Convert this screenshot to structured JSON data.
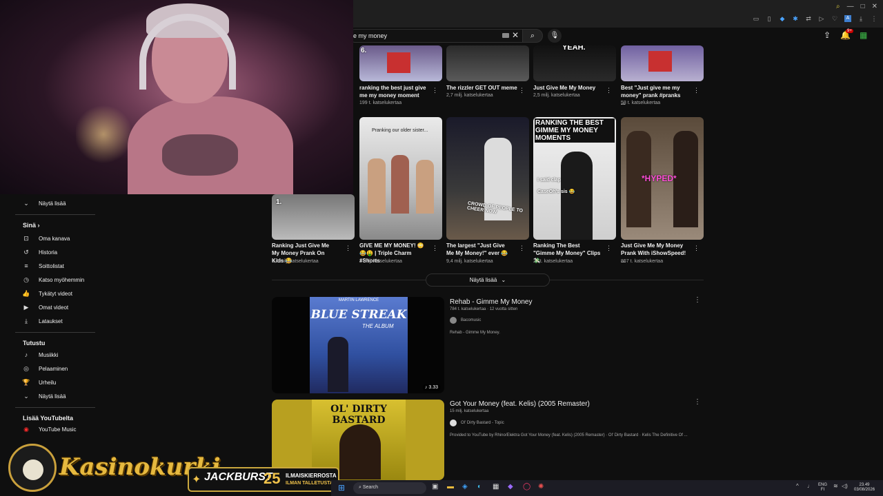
{
  "search": {
    "value": "e my money",
    "placeholder": ""
  },
  "sidebar": {
    "show_more_1": "Näytä lisää",
    "section_you": "Sinä",
    "you_items": [
      "Oma kanava",
      "Historia",
      "Soittolistat",
      "Katso myöhemmin",
      "Tykätyt videot",
      "Omat videot",
      "Lataukset"
    ],
    "section_explore": "Tutustu",
    "explore_items": [
      "Musiikki",
      "Pelaaminen",
      "Urheilu"
    ],
    "show_more_2": "Näytä lisää",
    "section_more": "Lisää YouTubelta",
    "more_items": [
      "YouTube Music"
    ]
  },
  "shorts_row1": [
    {
      "title": "ranking the best just give me my money moment",
      "views": "199 t. katselukertaa",
      "thumb_text": "6."
    },
    {
      "title": "The rizzler GET OUT meme",
      "views": "2,7 milj. katselukertaa",
      "thumb_text": ""
    },
    {
      "title": "Just Give Me My Money",
      "views": "2,5 milj. katselukertaa",
      "thumb_text": "YEAH."
    },
    {
      "title": "Best \"Just give me my money\" prank #pranks ...",
      "views": "58 t. katselukertaa",
      "thumb_text": ""
    }
  ],
  "shorts_row2": [
    {
      "title": "Ranking Just Give Me My Money Prank On Kids 😂",
      "views": "1,4 milj. katselukertaa",
      "thumb_text": "1."
    },
    {
      "title": "GIVE ME MY MONEY! 😳😂🤑 | Triple Charm #Shorts",
      "views": "3 milj. katselukertaa",
      "thumb_text": "Pranking our older sister..."
    },
    {
      "title": "The largest \"Just Give Me My Money!\" ever 😂",
      "views": "9,4 milj. katselukertaa",
      "thumb_text": "CROWD OF PEOPLE TO CHEER NOW"
    },
    {
      "title": "Ranking The Best \"Gimme My Money\" Clips 💸",
      "views": "27 t. katselukertaa",
      "thumb_text": "RANKING THE BEST GIMME MY MONEY MOMENTS"
    },
    {
      "title": "Just Give Me My Money Prank With iShowSpeed! ...",
      "views": "867 t. katselukertaa",
      "thumb_text": "*HYPED*"
    }
  ],
  "thumb_extra": {
    "clap": "I said clap",
    "sis": "CaseOh's sis 😂"
  },
  "show_more_center": "Näytä lisää",
  "videos": [
    {
      "title": "Rehab - Gimme My Money",
      "meta": "784 t. katselukertaa · 12 vuotta sitten",
      "channel": "Bacomusic",
      "desc": "Rehab - Gimme My Money.",
      "duration": "♪ 3.33",
      "cover_top": "MARTIN LAWRENCE",
      "cover_title": "BLUE STREAK",
      "cover_sub": "THE ALBUM"
    },
    {
      "title": "Got Your Money (feat. Kelis) (2005 Remaster)",
      "meta": "15 milj. katselukertaa",
      "channel": "Ol' Dirty Bastard - Topic",
      "desc": "Provided to YouTube by Rhino/Elektra Got Your Money (feat. Kelis) (2005 Remaster) · Ol' Dirty Bastard · Kelis The Definitive Of ...",
      "cover_text": "OL' DIRTY BASTARD"
    }
  ],
  "casino": {
    "brand": "Kasinokurki",
    "promo_word": "JACKBURST",
    "promo_num": "25",
    "promo_line1": "ILMAISKIERROSTA",
    "promo_line2": "ILMAN TALLETUSTA"
  },
  "taskbar": {
    "search": "Search",
    "lang1": "ENG",
    "lang2": "FI",
    "time": "23.49",
    "date": "03/08/2026"
  },
  "colors": {
    "background": "#0f0f0f",
    "text": "#f1f1f1",
    "muted": "#aaaaaa",
    "accent_red": "#cc0000",
    "casino_gold": "#e6b93f"
  }
}
